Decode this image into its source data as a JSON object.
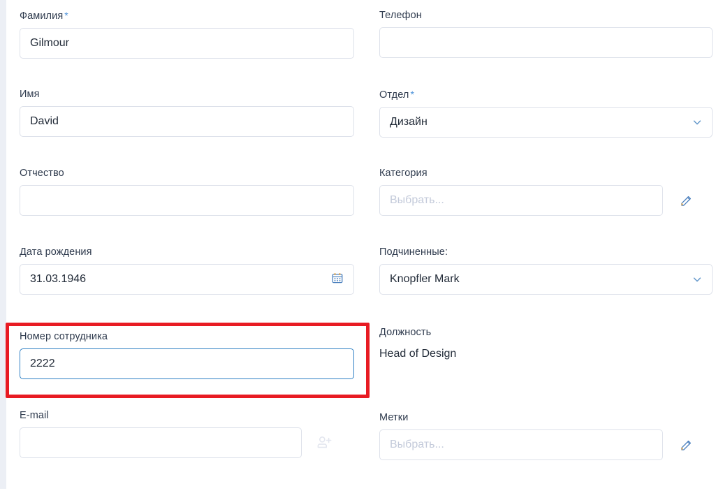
{
  "form": {
    "fields": {
      "last_name": {
        "label": "Фамилия",
        "required": true,
        "value": "Gilmour",
        "placeholder": ""
      },
      "phone": {
        "label": "Телефон",
        "required": false,
        "value": "",
        "placeholder": ""
      },
      "first_name": {
        "label": "Имя",
        "required": false,
        "value": "David",
        "placeholder": ""
      },
      "department": {
        "label": "Отдел",
        "required": true,
        "value": "Дизайн",
        "placeholder": ""
      },
      "middle_name": {
        "label": "Отчество",
        "required": false,
        "value": "",
        "placeholder": ""
      },
      "category": {
        "label": "Категория",
        "required": false,
        "value": "",
        "placeholder": "Выбрать..."
      },
      "birth_date": {
        "label": "Дата рождения",
        "required": false,
        "value": "31.03.1946",
        "placeholder": ""
      },
      "subordinates": {
        "label": "Подчиненные:",
        "required": false,
        "value": "Knopfler Mark",
        "placeholder": ""
      },
      "employee_no": {
        "label": "Номер сотрудника",
        "required": false,
        "value": "2222",
        "placeholder": "",
        "focused": true
      },
      "position": {
        "label": "Должность",
        "required": false,
        "value": "Head of Design",
        "placeholder": ""
      },
      "email": {
        "label": "E-mail",
        "required": false,
        "value": "",
        "placeholder": ""
      },
      "tags": {
        "label": "Метки",
        "required": false,
        "value": "",
        "placeholder": "Выбрать..."
      }
    },
    "required_marker": "*",
    "icons": {
      "calendar": "calendar-icon",
      "chevron_department": "chevron-down-icon",
      "chevron_subordinates": "chevron-down-icon",
      "pencil_category": "pencil-edit-icon",
      "pencil_tags": "pencil-edit-icon",
      "add_user": "add-user-icon"
    },
    "annotation": {
      "type": "highlight-rectangle",
      "color": "#e81b23",
      "targets": "employee_no"
    },
    "colors": {
      "accent": "#2f80c4",
      "required_star": "#4a90d9",
      "label_text": "#2e3a4d",
      "value_text": "#222b38",
      "input_border": "#dde1ea",
      "placeholder": "#c3cada",
      "highlight": "#e81b23",
      "gutter": "#eceff5"
    }
  }
}
